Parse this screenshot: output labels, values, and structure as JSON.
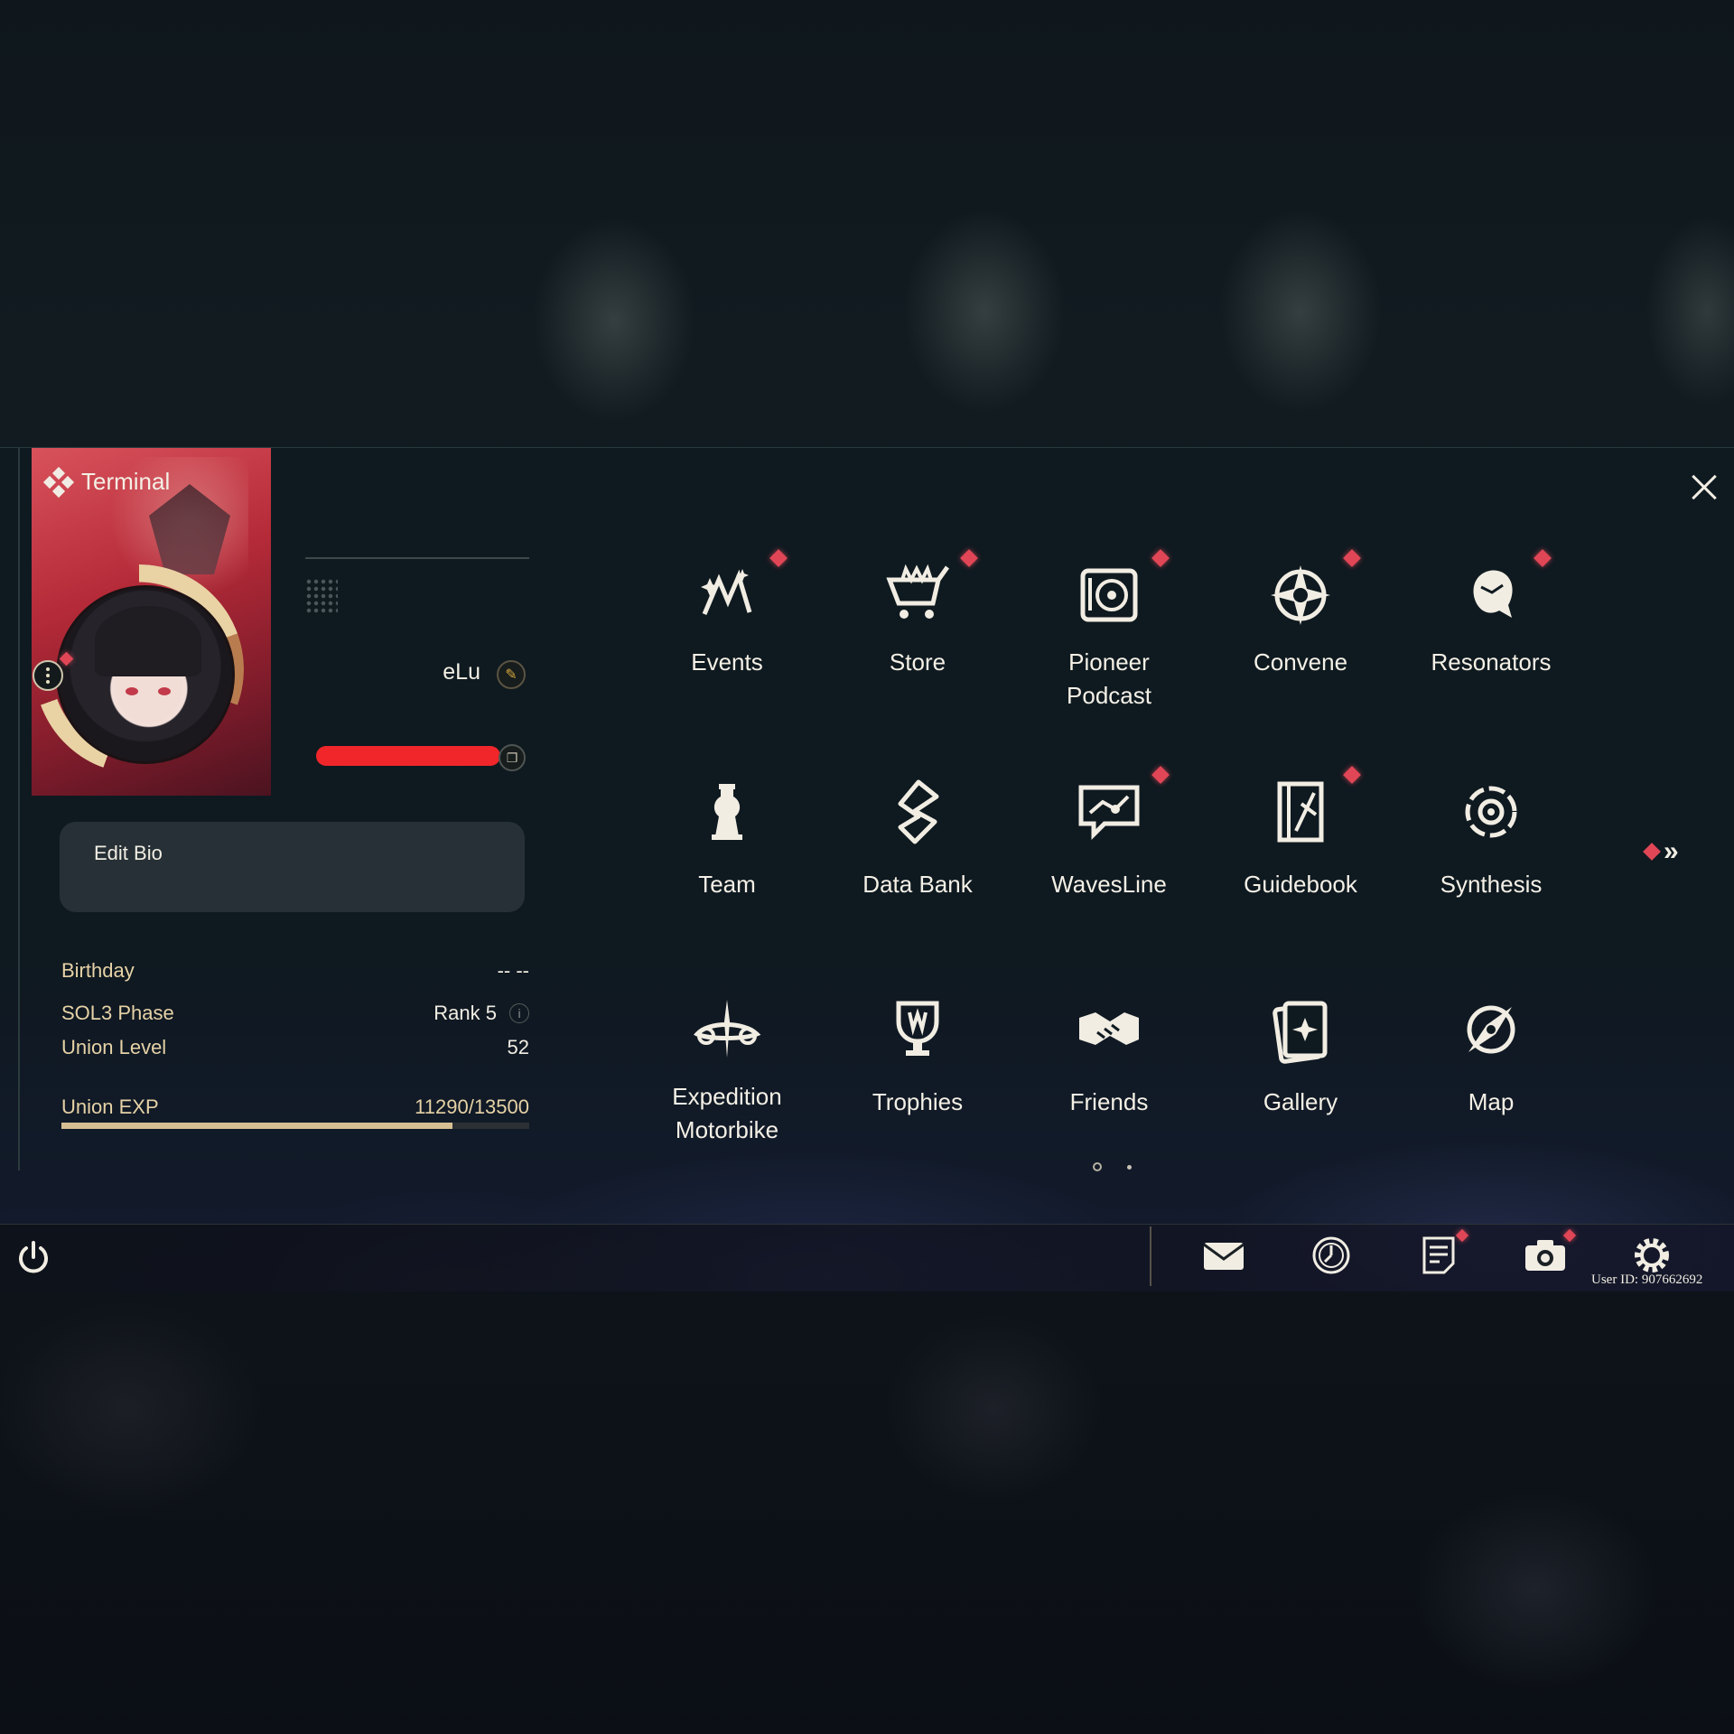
{
  "header": {
    "title": "Terminal"
  },
  "profile": {
    "username": "eLu",
    "edit_bio_label": "Edit Bio",
    "info": [
      {
        "label": "Birthday",
        "value": "-- --"
      },
      {
        "label": "SOL3 Phase",
        "value": "Rank 5"
      },
      {
        "label": "Union Level",
        "value": "52"
      }
    ],
    "union_exp": {
      "label": "Union EXP",
      "value": "11290/13500",
      "progress": 0.836
    }
  },
  "menu": {
    "items": [
      {
        "label": "Events",
        "icon": "events-icon",
        "notification": true
      },
      {
        "label": "Store",
        "icon": "store-cart-icon",
        "notification": true
      },
      {
        "label": "Pioneer\nPodcast",
        "icon": "podcast-record-icon",
        "notification": true
      },
      {
        "label": "Convene",
        "icon": "convene-compass-icon",
        "notification": true
      },
      {
        "label": "Resonators",
        "icon": "resonators-character-icon",
        "notification": true
      },
      {
        "label": "Team",
        "icon": "team-chess-icon",
        "notification": false
      },
      {
        "label": "Data Bank",
        "icon": "data-bank-icon",
        "notification": false
      },
      {
        "label": "WavesLine",
        "icon": "wavesline-chat-icon",
        "notification": true
      },
      {
        "label": "Guidebook",
        "icon": "guidebook-icon",
        "notification": true
      },
      {
        "label": "Synthesis",
        "icon": "synthesis-icon",
        "notification": false
      },
      {
        "label": "Expedition\nMotorbike",
        "icon": "motorbike-icon",
        "notification": false
      },
      {
        "label": "Trophies",
        "icon": "trophy-icon",
        "notification": false
      },
      {
        "label": "Friends",
        "icon": "handshake-icon",
        "notification": false
      },
      {
        "label": "Gallery",
        "icon": "gallery-card-icon",
        "notification": false
      },
      {
        "label": "Map",
        "icon": "map-compass-icon",
        "notification": false
      }
    ],
    "next_page_glyph": "»",
    "pages": 2,
    "current_page": 1
  },
  "bottom_bar": {
    "icons": [
      "mail-icon",
      "clock-icon",
      "notes-icon",
      "camera-icon",
      "settings-gear-icon"
    ],
    "user_id": "User ID: 907662692"
  },
  "colors": {
    "accent_gold": "#d6bf92",
    "notification": "#e04656",
    "card_red": "#b52a38"
  }
}
